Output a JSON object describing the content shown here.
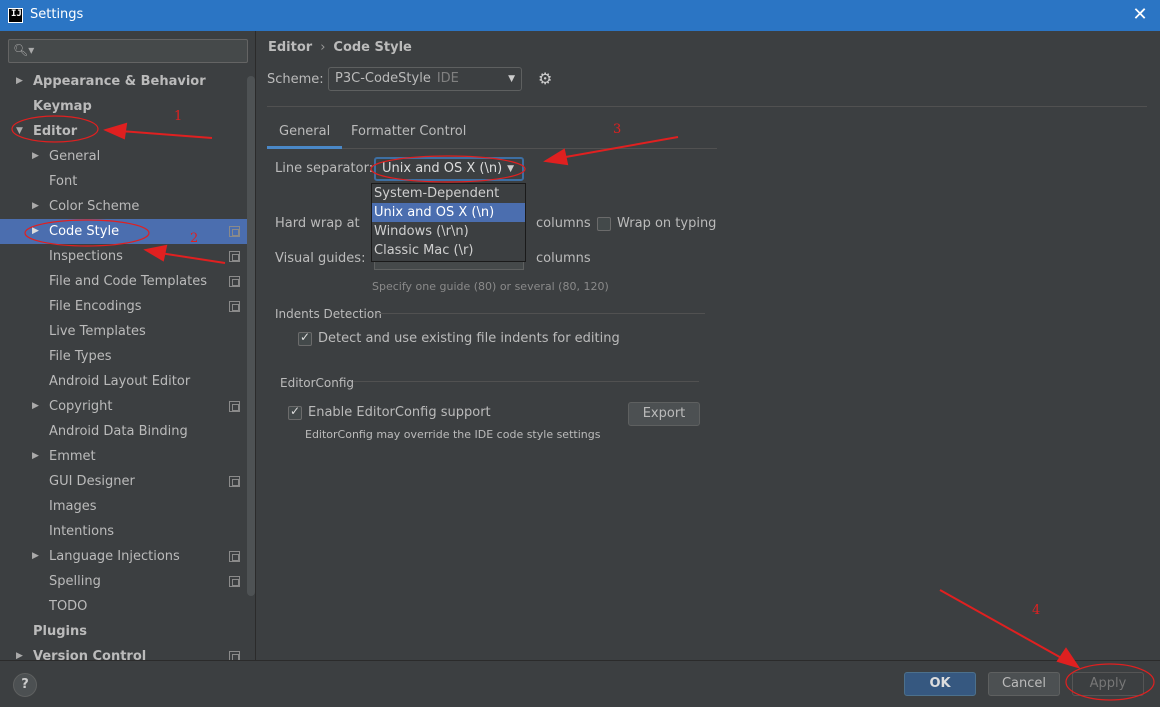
{
  "window": {
    "title": "Settings",
    "icon_text": "IJ"
  },
  "search": {
    "icon": "search-icon",
    "placeholder": ""
  },
  "sidebar": {
    "items": [
      {
        "label": "Appearance & Behavior"
      },
      {
        "label": "Keymap"
      },
      {
        "label": "Editor"
      },
      {
        "label": "General"
      },
      {
        "label": "Font"
      },
      {
        "label": "Color Scheme"
      },
      {
        "label": "Code Style"
      },
      {
        "label": "Inspections"
      },
      {
        "label": "File and Code Templates"
      },
      {
        "label": "File Encodings"
      },
      {
        "label": "Live Templates"
      },
      {
        "label": "File Types"
      },
      {
        "label": "Android Layout Editor"
      },
      {
        "label": "Copyright"
      },
      {
        "label": "Android Data Binding"
      },
      {
        "label": "Emmet"
      },
      {
        "label": "GUI Designer"
      },
      {
        "label": "Images"
      },
      {
        "label": "Intentions"
      },
      {
        "label": "Language Injections"
      },
      {
        "label": "Spelling"
      },
      {
        "label": "TODO"
      },
      {
        "label": "Plugins"
      },
      {
        "label": "Version Control"
      }
    ]
  },
  "breadcrumb": {
    "parent": "Editor",
    "separator": "›",
    "current": "Code Style"
  },
  "scheme": {
    "label": "Scheme:",
    "value": "P3C-CodeStyle",
    "suffix": "IDE"
  },
  "tabs": [
    {
      "label": "General"
    },
    {
      "label": "Formatter Control"
    }
  ],
  "line_separator": {
    "label": "Line separator:",
    "value": "Unix and OS X (\\n)",
    "options": [
      "System-Dependent",
      "Unix and OS X (\\n)",
      "Windows (\\r\\n)",
      "Classic Mac (\\r)"
    ]
  },
  "hard_wrap": {
    "label": "Hard wrap at",
    "unit": "columns",
    "wrap_on_typing": "Wrap on typing"
  },
  "visual_guides": {
    "label": "Visual guides:",
    "unit": "columns",
    "hint": "Specify one guide (80) or several (80, 120)"
  },
  "indents": {
    "title": "Indents Detection",
    "checkbox": "Detect and use existing file indents for editing"
  },
  "editorconfig": {
    "title": "EditorConfig",
    "checkbox": "Enable EditorConfig support",
    "export": "Export",
    "note": "EditorConfig may override the IDE code style settings"
  },
  "footer": {
    "help": "?",
    "ok": "OK",
    "cancel": "Cancel",
    "apply": "Apply"
  },
  "annotations": {
    "n1": "1",
    "n2": "2",
    "n3": "3",
    "n4": "4",
    "color": "#e02020"
  }
}
